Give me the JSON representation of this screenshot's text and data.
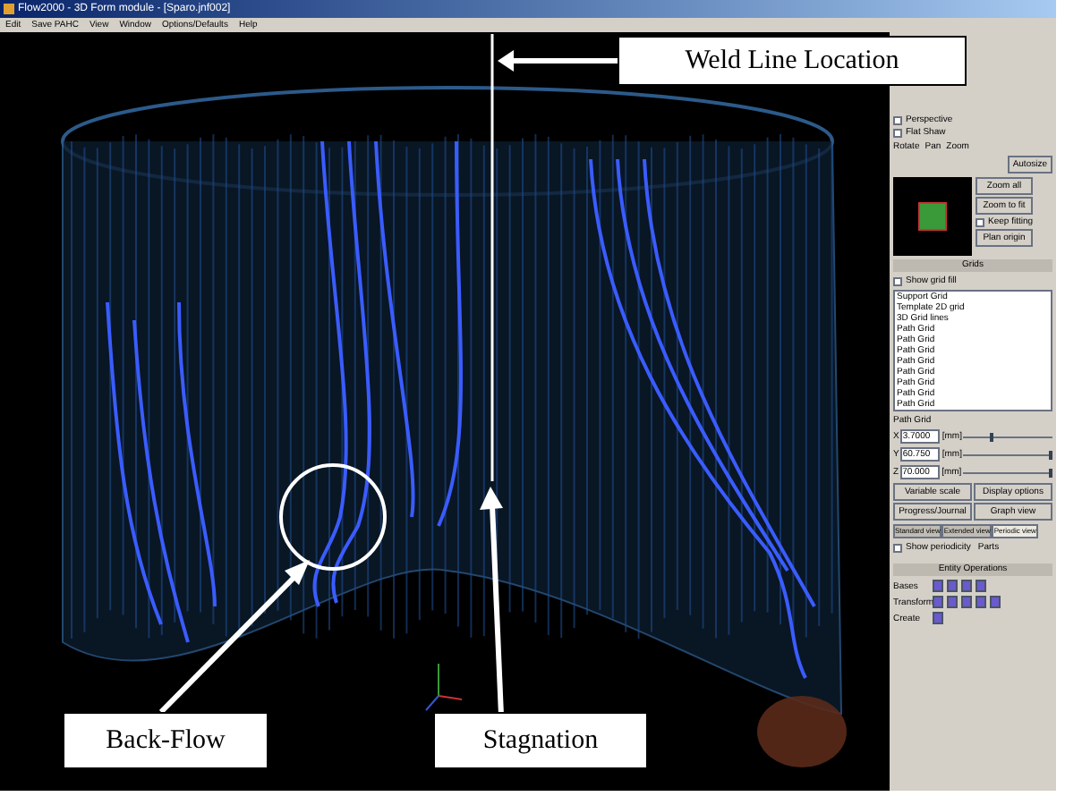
{
  "window": {
    "title": "Flow2000 - 3D Form module - [Sparo.jnf002]",
    "menu": [
      "Edit",
      "Save PAHC",
      "View",
      "Window",
      "Options/Defaults",
      "Help"
    ]
  },
  "annotations": [
    {
      "kind": "top",
      "label": "Weld Line Location"
    },
    {
      "kind": "left",
      "label": "Back-Flow"
    },
    {
      "kind": "bottom",
      "label": "Stagnation"
    }
  ],
  "view_panel": {
    "checks": [
      {
        "label": "Perspective",
        "checked": false
      },
      {
        "label": "Flat Shaw",
        "checked": false
      }
    ],
    "groups": [
      "Rotate",
      "Pan",
      "Zoom"
    ],
    "autosize": "Autosize",
    "buttons": [
      "Zoom all",
      "Zoom to fit",
      "Plan origin"
    ],
    "keep_fitting": {
      "label": "Keep fitting",
      "checked": false
    }
  },
  "grids": {
    "title": "Grids",
    "show_fill": {
      "label": "Show grid fill",
      "checked": false
    },
    "items": [
      {
        "name": "Support Grid"
      },
      {
        "name": "Template 2D grid"
      },
      {
        "name": "3D Grid lines"
      },
      {
        "name": "Path Grid"
      },
      {
        "name": "Path Grid"
      },
      {
        "name": "Path Grid"
      },
      {
        "name": "Path Grid"
      },
      {
        "name": "Path Grid"
      },
      {
        "name": "Path Grid"
      },
      {
        "name": "Path Grid"
      },
      {
        "name": "Path Grid"
      }
    ],
    "selected_label": "Path Grid",
    "fields": [
      {
        "axis": "X",
        "value": "3.7000",
        "unit": "[mm]",
        "level": 0.3
      },
      {
        "axis": "Y",
        "value": "60.750",
        "unit": "[mm]",
        "level": 0.95
      },
      {
        "axis": "Z",
        "value": "70.000",
        "unit": "[mm]",
        "level": 0.95
      }
    ],
    "buttons": [
      "Variable scale",
      "Display options",
      "Progress/Journal",
      "Graph view"
    ],
    "tabs": [
      {
        "label": "Standard view",
        "selected": false
      },
      {
        "label": "Extended view",
        "selected": false
      },
      {
        "label": "Periodic view",
        "selected": true
      }
    ],
    "periodicity": {
      "label": "Show periodicity",
      "checked": false
    },
    "parts_label": "Parts"
  },
  "entity": {
    "title": "Entity Operations",
    "rows": [
      {
        "label": "Bases"
      },
      {
        "label": "Transform"
      },
      {
        "label": "Create"
      }
    ]
  }
}
